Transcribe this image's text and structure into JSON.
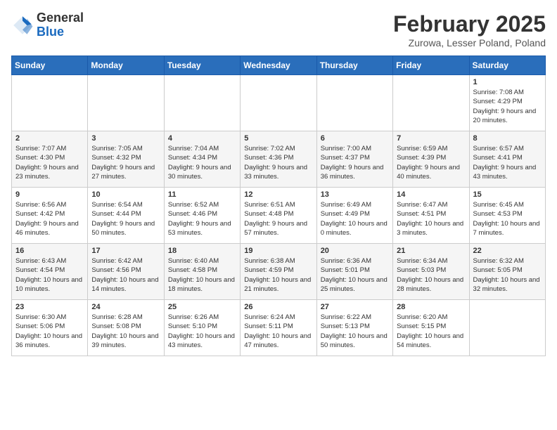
{
  "header": {
    "logo_general": "General",
    "logo_blue": "Blue",
    "month_year": "February 2025",
    "location": "Zurowa, Lesser Poland, Poland"
  },
  "weekdays": [
    "Sunday",
    "Monday",
    "Tuesday",
    "Wednesday",
    "Thursday",
    "Friday",
    "Saturday"
  ],
  "weeks": [
    [
      {
        "day": "",
        "info": ""
      },
      {
        "day": "",
        "info": ""
      },
      {
        "day": "",
        "info": ""
      },
      {
        "day": "",
        "info": ""
      },
      {
        "day": "",
        "info": ""
      },
      {
        "day": "",
        "info": ""
      },
      {
        "day": "1",
        "info": "Sunrise: 7:08 AM\nSunset: 4:29 PM\nDaylight: 9 hours and 20 minutes."
      }
    ],
    [
      {
        "day": "2",
        "info": "Sunrise: 7:07 AM\nSunset: 4:30 PM\nDaylight: 9 hours and 23 minutes."
      },
      {
        "day": "3",
        "info": "Sunrise: 7:05 AM\nSunset: 4:32 PM\nDaylight: 9 hours and 27 minutes."
      },
      {
        "day": "4",
        "info": "Sunrise: 7:04 AM\nSunset: 4:34 PM\nDaylight: 9 hours and 30 minutes."
      },
      {
        "day": "5",
        "info": "Sunrise: 7:02 AM\nSunset: 4:36 PM\nDaylight: 9 hours and 33 minutes."
      },
      {
        "day": "6",
        "info": "Sunrise: 7:00 AM\nSunset: 4:37 PM\nDaylight: 9 hours and 36 minutes."
      },
      {
        "day": "7",
        "info": "Sunrise: 6:59 AM\nSunset: 4:39 PM\nDaylight: 9 hours and 40 minutes."
      },
      {
        "day": "8",
        "info": "Sunrise: 6:57 AM\nSunset: 4:41 PM\nDaylight: 9 hours and 43 minutes."
      }
    ],
    [
      {
        "day": "9",
        "info": "Sunrise: 6:56 AM\nSunset: 4:42 PM\nDaylight: 9 hours and 46 minutes."
      },
      {
        "day": "10",
        "info": "Sunrise: 6:54 AM\nSunset: 4:44 PM\nDaylight: 9 hours and 50 minutes."
      },
      {
        "day": "11",
        "info": "Sunrise: 6:52 AM\nSunset: 4:46 PM\nDaylight: 9 hours and 53 minutes."
      },
      {
        "day": "12",
        "info": "Sunrise: 6:51 AM\nSunset: 4:48 PM\nDaylight: 9 hours and 57 minutes."
      },
      {
        "day": "13",
        "info": "Sunrise: 6:49 AM\nSunset: 4:49 PM\nDaylight: 10 hours and 0 minutes."
      },
      {
        "day": "14",
        "info": "Sunrise: 6:47 AM\nSunset: 4:51 PM\nDaylight: 10 hours and 3 minutes."
      },
      {
        "day": "15",
        "info": "Sunrise: 6:45 AM\nSunset: 4:53 PM\nDaylight: 10 hours and 7 minutes."
      }
    ],
    [
      {
        "day": "16",
        "info": "Sunrise: 6:43 AM\nSunset: 4:54 PM\nDaylight: 10 hours and 10 minutes."
      },
      {
        "day": "17",
        "info": "Sunrise: 6:42 AM\nSunset: 4:56 PM\nDaylight: 10 hours and 14 minutes."
      },
      {
        "day": "18",
        "info": "Sunrise: 6:40 AM\nSunset: 4:58 PM\nDaylight: 10 hours and 18 minutes."
      },
      {
        "day": "19",
        "info": "Sunrise: 6:38 AM\nSunset: 4:59 PM\nDaylight: 10 hours and 21 minutes."
      },
      {
        "day": "20",
        "info": "Sunrise: 6:36 AM\nSunset: 5:01 PM\nDaylight: 10 hours and 25 minutes."
      },
      {
        "day": "21",
        "info": "Sunrise: 6:34 AM\nSunset: 5:03 PM\nDaylight: 10 hours and 28 minutes."
      },
      {
        "day": "22",
        "info": "Sunrise: 6:32 AM\nSunset: 5:05 PM\nDaylight: 10 hours and 32 minutes."
      }
    ],
    [
      {
        "day": "23",
        "info": "Sunrise: 6:30 AM\nSunset: 5:06 PM\nDaylight: 10 hours and 36 minutes."
      },
      {
        "day": "24",
        "info": "Sunrise: 6:28 AM\nSunset: 5:08 PM\nDaylight: 10 hours and 39 minutes."
      },
      {
        "day": "25",
        "info": "Sunrise: 6:26 AM\nSunset: 5:10 PM\nDaylight: 10 hours and 43 minutes."
      },
      {
        "day": "26",
        "info": "Sunrise: 6:24 AM\nSunset: 5:11 PM\nDaylight: 10 hours and 47 minutes."
      },
      {
        "day": "27",
        "info": "Sunrise: 6:22 AM\nSunset: 5:13 PM\nDaylight: 10 hours and 50 minutes."
      },
      {
        "day": "28",
        "info": "Sunrise: 6:20 AM\nSunset: 5:15 PM\nDaylight: 10 hours and 54 minutes."
      },
      {
        "day": "",
        "info": ""
      }
    ]
  ]
}
